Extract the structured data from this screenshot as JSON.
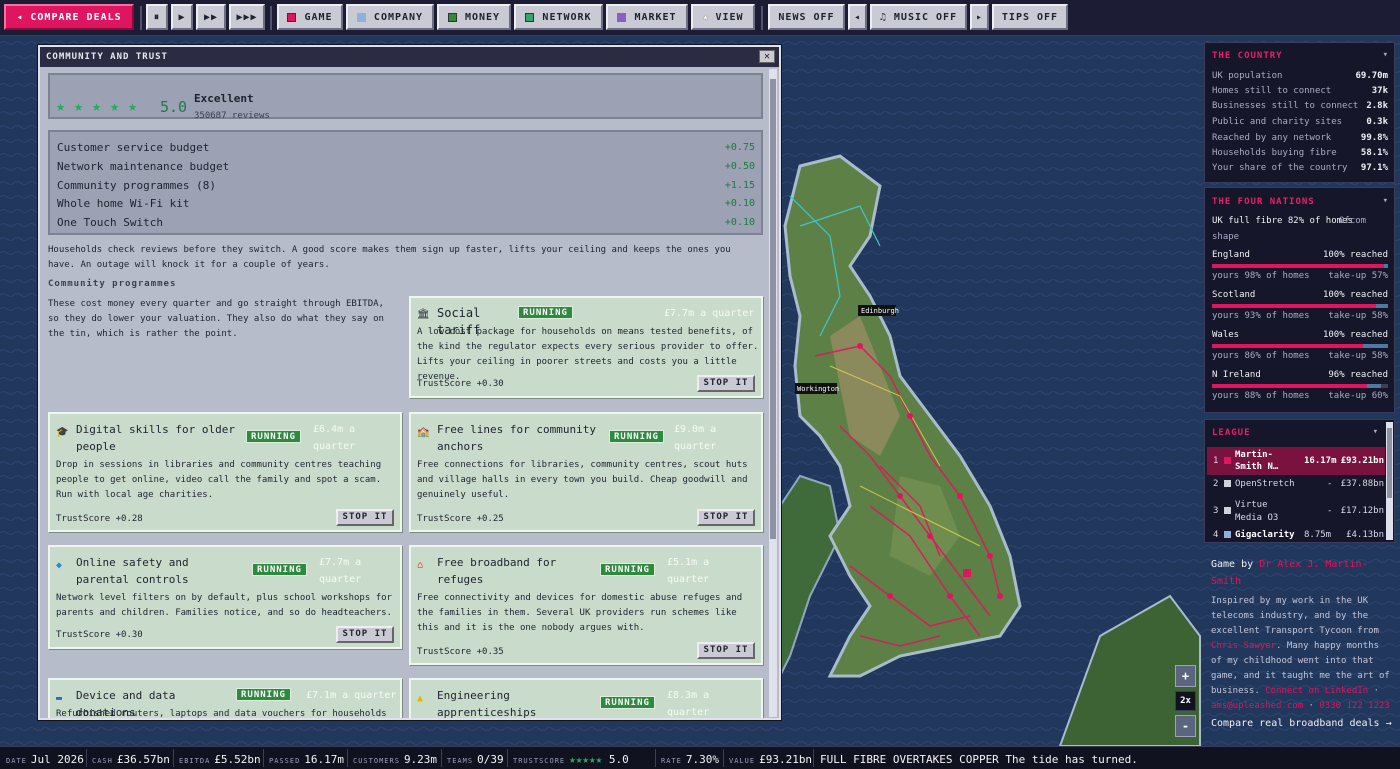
{
  "toolbar": {
    "compare_deals": "◂ COMPARE DEALS",
    "pause": "⏸",
    "play": "▶",
    "fast": "▶▶",
    "fastest": "▶▶▶",
    "game": "GAME",
    "company": "COMPANY",
    "money": "MONEY",
    "network": "NETWORK",
    "market": "MARKET",
    "view": "VIEW",
    "news": "NEWS OFF",
    "prev_track": "◂",
    "music": "♫ MUSIC OFF",
    "next_track": "▸",
    "tips": "TIPS OFF"
  },
  "dialog": {
    "title": "COMMUNITY AND TRUST",
    "close": "✕",
    "rating": {
      "stars": 5,
      "score": "5.0",
      "label": "Excellent",
      "reviews": "350687 reviews"
    },
    "budget": [
      {
        "label": "Customer service budget",
        "value": "+0.75"
      },
      {
        "label": "Network maintenance budget",
        "value": "+0.50"
      },
      {
        "label": "Community programmes (8)",
        "value": "+1.15"
      },
      {
        "label": "Whole home Wi-Fi kit",
        "value": "+0.10"
      },
      {
        "label": "One Touch Switch",
        "value": "+0.10"
      }
    ],
    "intro": "Households check reviews before they switch. A good score makes them sign up faster, lifts your ceiling and keeps the ones you have. An outage will knock it for a couple of years.",
    "section_title": "Community programmes",
    "section_intro": "These cost money every quarter and go straight through EBITDA, so they do lower your valuation. They also do what they say on the tin, which is rather the point.",
    "running_label": "RUNNING",
    "stop_label": "STOP IT",
    "programmes": [
      {
        "title": "Social tariff",
        "cost": "£7.7m a quarter",
        "desc": "A low cost package for households on means tested benefits, of the kind the regulator expects every serious provider to offer. Lifts your ceiling in poorer streets and costs you a little revenue.",
        "trust": "TrustScore +0.30",
        "icon": "house-icon"
      },
      {
        "title": "Digital skills for older people",
        "cost": "£6.4m a quarter",
        "desc": "Drop in sessions in libraries and community centres teaching people to get online, video call the family and spot a scam. Run with local age charities.",
        "trust": "TrustScore +0.28",
        "icon": "cap-icon"
      },
      {
        "title": "Free lines for community anchors",
        "cost": "£9.0m a quarter",
        "desc": "Free connections for libraries, community centres, scout huts and village halls in every town you build. Cheap goodwill and genuinely useful.",
        "trust": "TrustScore +0.25",
        "icon": "building-icon"
      },
      {
        "title": "Online safety and parental controls",
        "cost": "£7.7m a quarter",
        "desc": "Network level filters on by default, plus school workshops for parents and children. Families notice, and so do headteachers.",
        "trust": "TrustScore +0.30",
        "icon": "shield-icon"
      },
      {
        "title": "Free broadband for refuges",
        "cost": "£5.1m a quarter",
        "desc": "Free connectivity and devices for domestic abuse refuges and the families in them. Several UK providers run schemes like this and it is the one nobody argues with.",
        "trust": "TrustScore +0.35",
        "icon": "home-heart-icon"
      },
      {
        "title": "Device and data donations",
        "cost": "£7.1m a quarter",
        "desc": "Refurbished routers, laptops and data vouchers for households who",
        "trust": "",
        "icon": "laptop-icon"
      },
      {
        "title": "Engineering apprenticeships",
        "cost": "£8.3m a quarter",
        "desc": "",
        "trust": "",
        "icon": "helmet-icon"
      }
    ]
  },
  "map": {
    "labels": [
      "Edinburgh",
      "Workington"
    ]
  },
  "country": {
    "title": "THE COUNTRY",
    "collapse": "▾",
    "rows": [
      {
        "label": "UK population",
        "value": "69.70m"
      },
      {
        "label": "Homes still to connect",
        "value": "37k"
      },
      {
        "label": "Businesses still to connect",
        "value": "2.8k"
      },
      {
        "label": "Public and charity sites",
        "value": "0.3k"
      },
      {
        "label": "Reached by any network",
        "value": "99.8%"
      },
      {
        "label": "Households buying fibre",
        "value": "58.1%"
      },
      {
        "label": "Your share of the country",
        "value": "97.1%"
      }
    ]
  },
  "nations": {
    "title": "THE FOUR NATIONS",
    "collapse": "▾",
    "headline": "UK full fibre 82% of homes",
    "source": "Ofcom",
    "shape": "shape",
    "items": [
      {
        "name": "England",
        "reached": "100% reached",
        "yours": "yours 98% of homes",
        "takeup": "take-up 57%",
        "reach_frac": 1.0,
        "yours_frac": 0.98,
        "takeup_frac": 0.57
      },
      {
        "name": "Scotland",
        "reached": "100% reached",
        "yours": "yours 93% of homes",
        "takeup": "take-up 58%",
        "reach_frac": 1.0,
        "yours_frac": 0.93,
        "takeup_frac": 0.58
      },
      {
        "name": "Wales",
        "reached": "100% reached",
        "yours": "yours 86% of homes",
        "takeup": "take-up 58%",
        "reach_frac": 1.0,
        "yours_frac": 0.86,
        "takeup_frac": 0.58
      },
      {
        "name": "N Ireland",
        "reached": "96% reached",
        "yours": "yours 88% of homes",
        "takeup": "take-up 60%",
        "reach_frac": 0.96,
        "yours_frac": 0.88,
        "takeup_frac": 0.6
      }
    ]
  },
  "league": {
    "title": "LEAGUE",
    "collapse": "▾",
    "rows": [
      {
        "rank": "1",
        "name": "Martin-Smith N…",
        "homes": "16.17m",
        "value": "£93.21bn",
        "color": "#e0155f"
      },
      {
        "rank": "2",
        "name": "OpenStretch",
        "homes": "-",
        "value": "£37.88bn",
        "color": "#cfd2dd"
      },
      {
        "rank": "3",
        "name": "Virtue Media O3",
        "homes": "-",
        "value": "£17.12bn",
        "color": "#cfd2dd"
      },
      {
        "rank": "4",
        "name": "Gigaclarity",
        "homes": "8.75m",
        "value": "£4.13bn",
        "color": "#8fb0d8"
      }
    ]
  },
  "credits": {
    "game_by": "Game by",
    "author": "Dr Alex J. Martin-Smith",
    "text1": "Inspired by my work in the UK telecoms industry, and by the excellent Transport Tycoon from",
    "chris": "Chris Sawyer",
    "text2": ". Many happy months of my childhood went into that game, and it taught me the art of business.",
    "linkedin": "Connect on LinkedIn",
    "dot": "·",
    "email": "ams@upleashed.com",
    "phone": "0330 122 1223",
    "compare": "Compare real broadband deals →"
  },
  "zoom": {
    "in": "+",
    "level": "2x",
    "out": "-"
  },
  "status": {
    "date_label": "DATE",
    "date": "Jul 2026",
    "cash_label": "CASH",
    "cash": "£36.57bn",
    "ebitda_label": "EBITDA",
    "ebitda": "£5.52bn",
    "passed_label": "PASSED",
    "passed": "16.17m",
    "customers_label": "CUSTOMERS",
    "customers": "9.23m",
    "teams_label": "TEAMS",
    "teams": "0/39",
    "trust_label": "TRUSTSCORE",
    "trust_stars": "★★★★★",
    "trust": "5.0",
    "rate_label": "RATE",
    "rate": "7.30%",
    "value_label": "VALUE",
    "value": "£93.21bn",
    "news": "FULL FIBRE OVERTAKES COPPER The tide has turned."
  },
  "colors": {
    "accent": "#e0155f",
    "running": "#2e8a3f",
    "star": "#2aa861"
  }
}
